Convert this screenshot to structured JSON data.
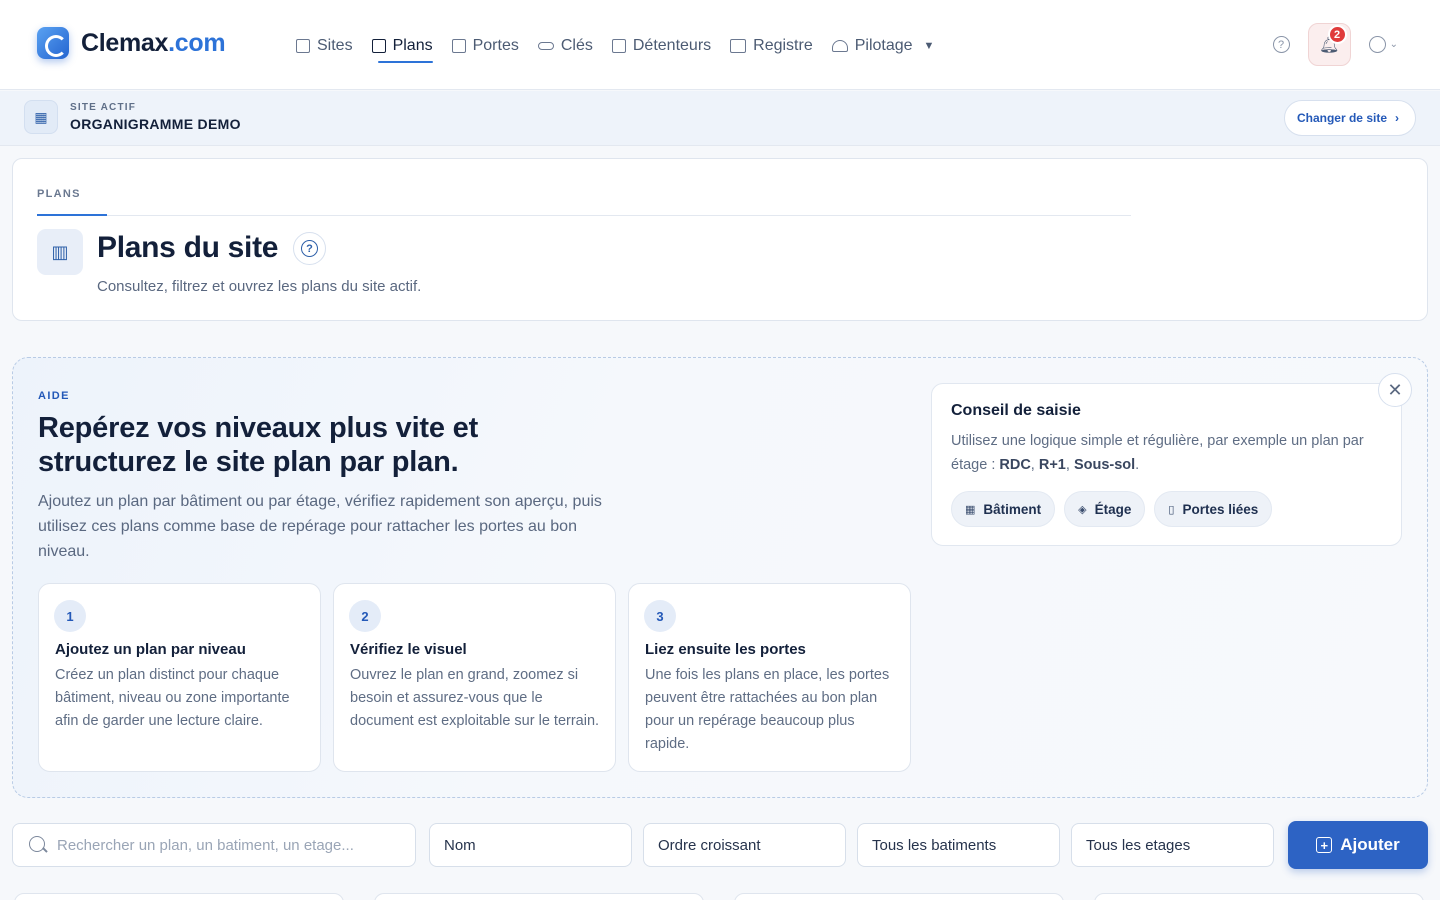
{
  "brand": {
    "name": "Clemax",
    "domain": ".com"
  },
  "nav": {
    "items": [
      {
        "label": "Sites",
        "icon": "building-icon"
      },
      {
        "label": "Plans",
        "icon": "map-icon",
        "active": true
      },
      {
        "label": "Portes",
        "icon": "door-icon"
      },
      {
        "label": "Clés",
        "icon": "key-icon"
      },
      {
        "label": "Détenteurs",
        "icon": "badge-icon"
      },
      {
        "label": "Registre",
        "icon": "book-icon"
      },
      {
        "label": "Pilotage",
        "icon": "gauge-icon"
      }
    ]
  },
  "notifications": {
    "count": "2"
  },
  "site": {
    "kicker": "SITE ACTIF",
    "name": "ORGANIGRAMME DEMO",
    "change_label": "Changer de site"
  },
  "page": {
    "breadcrumb": "PLANS",
    "title": "Plans du site",
    "subtitle": "Consultez, filtrez et ouvrez les plans du site actif."
  },
  "help": {
    "kicker": "AIDE",
    "title": "Repérez vos niveaux plus vite et structurez le site plan par plan.",
    "description": "Ajoutez un plan par bâtiment ou par étage, vérifiez rapidement son aperçu, puis utilisez ces plans comme base de repérage pour rattacher les portes au bon niveau.",
    "steps": [
      {
        "num": "1",
        "title": "Ajoutez un plan par niveau",
        "text": "Créez un plan distinct pour chaque bâtiment, niveau ou zone importante afin de garder une lecture claire."
      },
      {
        "num": "2",
        "title": "Vérifiez le visuel",
        "text": "Ouvrez le plan en grand, zoomez si besoin et assurez-vous que le document est exploitable sur le terrain."
      },
      {
        "num": "3",
        "title": "Liez ensuite les portes",
        "text": "Une fois les plans en place, les portes peuvent être rattachées au bon plan pour un repérage beaucoup plus rapide."
      }
    ],
    "tip": {
      "title": "Conseil de saisie",
      "text_prefix": "Utilisez une logique simple et régulière, par exemple un plan par étage : ",
      "ex1": "RDC",
      "sep1": ", ",
      "ex2": "R+1",
      "sep2": ", ",
      "ex3": "Sous-sol",
      "text_suffix": ".",
      "chips": [
        "Bâtiment",
        "Étage",
        "Portes liées"
      ]
    }
  },
  "filters": {
    "search_placeholder": "Rechercher un plan, un batiment, un etage...",
    "sort_field": "Nom",
    "sort_order": "Ordre croissant",
    "building": "Tous les batiments",
    "floor": "Tous les etages",
    "add_label": "Ajouter"
  }
}
